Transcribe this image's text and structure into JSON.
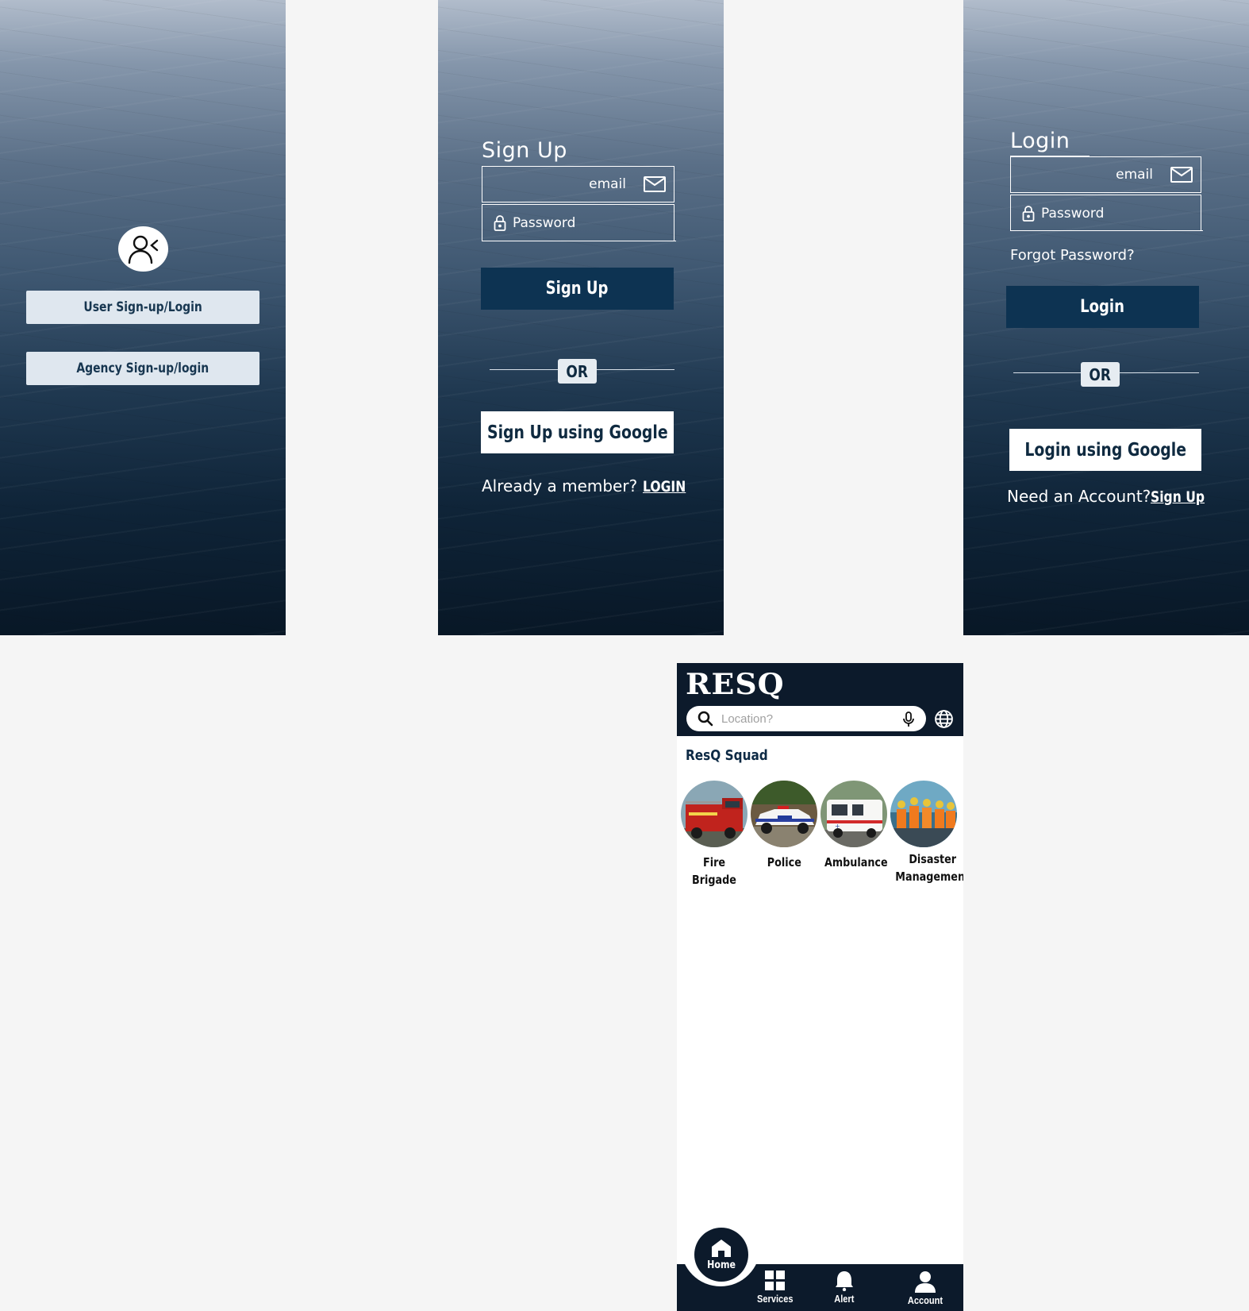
{
  "screen1": {
    "user_btn": "User Sign-up/Login",
    "agency_btn": "Agency Sign-up/login"
  },
  "signup": {
    "title": "Sign Up",
    "email_placeholder": "email",
    "password_placeholder": "Password",
    "submit": "Sign Up",
    "or": "OR",
    "google": "Sign Up using Google",
    "footer_text": "Already a member? ",
    "footer_link": "LOGIN"
  },
  "login": {
    "title": "Login",
    "email_placeholder": "email",
    "password_placeholder": "Password",
    "forgot": "Forgot Password?",
    "submit": "Login",
    "or": "OR",
    "google": "Login using Google",
    "footer_text": "Need an Account?",
    "footer_link": "Sign Up"
  },
  "home": {
    "logo": "RESQ",
    "search_placeholder": "Location?",
    "squad_title": "ResQ Squad",
    "squad": [
      {
        "label": "Fire Brigade"
      },
      {
        "label": "Police"
      },
      {
        "label": "Ambulance"
      },
      {
        "label": "Disaster Management"
      }
    ],
    "nav": {
      "home": "Home",
      "services": "Services",
      "alert": "Alert",
      "account": "Account"
    }
  },
  "colors": {
    "navy": "#0c1a2b",
    "button_navy": "#0d3352",
    "light_button": "#dfe7ef"
  }
}
